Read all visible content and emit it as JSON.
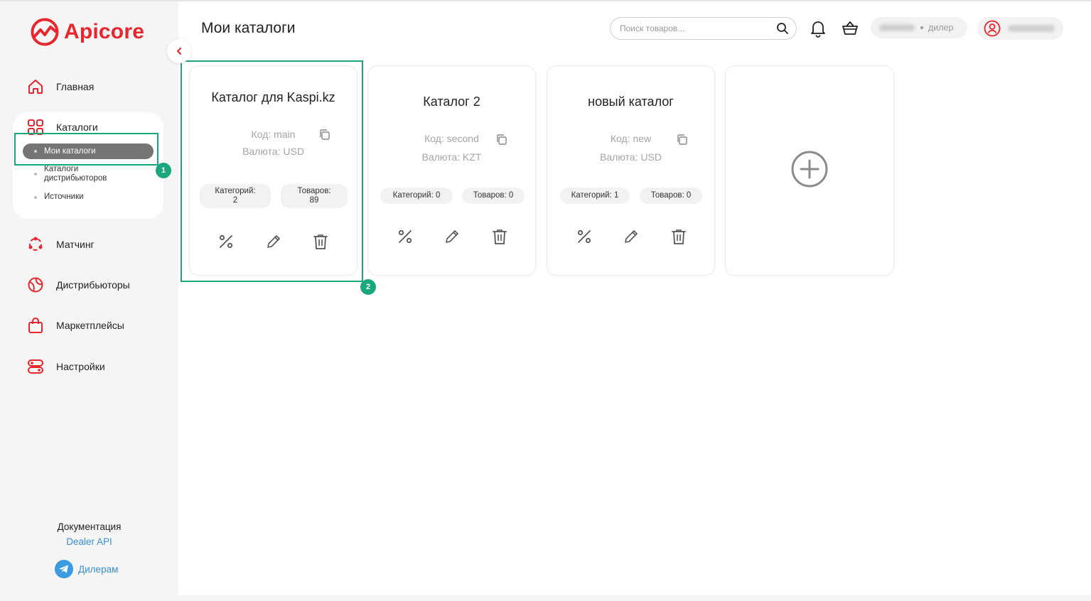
{
  "brand": {
    "name": "Apicore",
    "color": "#e8262d"
  },
  "sidebar": {
    "items": [
      {
        "label": "Главная",
        "icon": "home-icon"
      },
      {
        "label": "Каталоги",
        "icon": "grid-icon"
      },
      {
        "label": "Матчинг",
        "icon": "matching-icon"
      },
      {
        "label": "Дистрибьюторы",
        "icon": "globe-icon"
      },
      {
        "label": "Маркетплейсы",
        "icon": "shopping-bag-icon"
      },
      {
        "label": "Настройки",
        "icon": "settings-icon"
      }
    ],
    "catalog_sub": [
      {
        "label": "Мои каталоги",
        "active": true
      },
      {
        "label": "Каталоги\nдистрибьюторов",
        "active": false
      },
      {
        "label": "Источники",
        "active": false
      }
    ],
    "docs_title": "Документация",
    "docs_link": "Dealer API",
    "telegram_label": "Дилерам"
  },
  "header": {
    "title": "Мои каталоги",
    "search_placeholder": "Поиск товаров...",
    "dealer_role": "дилер"
  },
  "catalogs": [
    {
      "name": "Каталог для Kaspi.kz",
      "code": "Код: main",
      "currency": "Валюта: USD",
      "categories": "Категорий:\n2",
      "products": "Товаров:\n89"
    },
    {
      "name": "Каталог 2",
      "code": "Код: second",
      "currency": "Валюта: KZT",
      "categories": "Категорий: 0",
      "products": "Товаров: 0"
    },
    {
      "name": "новый каталог",
      "code": "Код: new",
      "currency": "Валюта: USD",
      "categories": "Категорий: 1",
      "products": "Товаров: 0"
    }
  ],
  "annotations": [
    {
      "number": "1"
    },
    {
      "number": "2"
    }
  ],
  "colors": {
    "accent": "#e8262d",
    "annotation": "#1aa77d",
    "link": "#3a8fd6",
    "active_pill": "#757575"
  }
}
